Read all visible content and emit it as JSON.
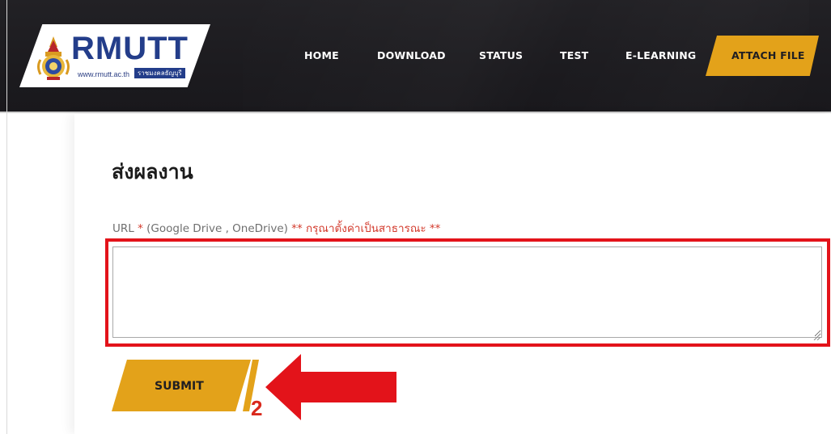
{
  "header": {
    "logo_text": "RMUTT",
    "logo_url": "www.rmutt.ac.th",
    "logo_thai": "ราชมงคลธัญบุรี"
  },
  "nav": {
    "home": "HOME",
    "download": "DOWNLOAD",
    "status": "STATUS",
    "test": "TEST",
    "elearning": "E-LEARNING",
    "attach_file": "ATTACH FILE",
    "active_item": "ATTACH FILE"
  },
  "main": {
    "title": "ส่งผลงาน",
    "url_field": {
      "label_prefix": "URL",
      "required_mark": "*",
      "label_hint": "(Google Drive , OneDrive)",
      "label_warning": "** กรุณาตั้งค่าเป็นสาธารณะ **",
      "value": ""
    },
    "submit_label": "SUBMIT"
  },
  "annotation": {
    "step_number": "2"
  },
  "colors": {
    "header_bg": "#1c1b1f",
    "accent": "#e3a21a",
    "brand_blue": "#233d8a",
    "warning_red": "#d33a2c",
    "annotation_red": "#e3131a"
  }
}
